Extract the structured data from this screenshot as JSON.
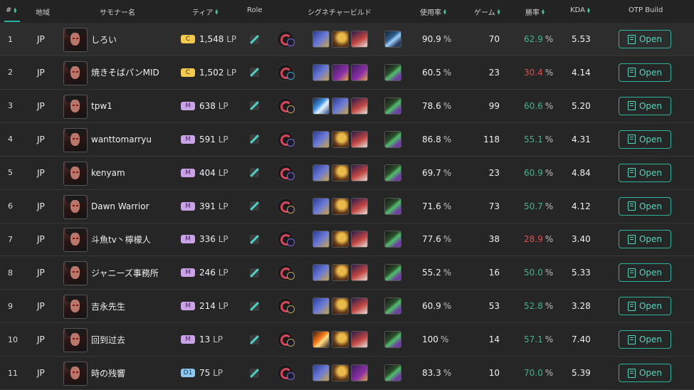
{
  "headers": {
    "rank": "#",
    "region": "地域",
    "summoner": "サモナー名",
    "tier": "ティア",
    "role": "Role",
    "build": "シグネチャービルド",
    "pickrate": "使用率",
    "games": "ゲーム",
    "winrate": "勝率",
    "kda": "KDA",
    "otp": "OTP Build"
  },
  "colors": {
    "accent": "#2fb39c",
    "good": "#3fb58c",
    "bad": "#e8484f"
  },
  "rows": [
    {
      "rank": "1",
      "region": "JP",
      "name": "しろい",
      "tier": "C",
      "lp": "1,548",
      "lp_unit": "LP",
      "pick": "90.9",
      "games": "70",
      "wr": "62.9",
      "wr_state": "good",
      "kda": "5.53",
      "button": "Open",
      "keystone_sub": "purple",
      "items": [
        "blue",
        "gold",
        "red"
      ],
      "boot": "blue"
    },
    {
      "rank": "2",
      "region": "JP",
      "name": "焼きそばパンMID",
      "tier": "C",
      "lp": "1,502",
      "lp_unit": "LP",
      "pick": "60.5",
      "games": "23",
      "wr": "30.4",
      "wr_state": "bad",
      "kda": "4.14",
      "button": "Open",
      "keystone_sub": "teal",
      "items": [
        "blue",
        "purple",
        "purple"
      ],
      "boot": "green"
    },
    {
      "rank": "3",
      "region": "JP",
      "name": "tpw1",
      "tier": "M",
      "lp": "638",
      "lp_unit": "LP",
      "pick": "78.6",
      "games": "99",
      "wr": "60.6",
      "wr_state": "good",
      "kda": "5.20",
      "button": "Open",
      "keystone_sub": "gold",
      "items": [
        "shard",
        "blue",
        "red"
      ],
      "boot": "green"
    },
    {
      "rank": "4",
      "region": "JP",
      "name": "wanttomarryu",
      "tier": "M",
      "lp": "591",
      "lp_unit": "LP",
      "pick": "86.8",
      "games": "118",
      "wr": "55.1",
      "wr_state": "good",
      "kda": "4.31",
      "button": "Open",
      "keystone_sub": "purple",
      "items": [
        "blue",
        "gold",
        "red"
      ],
      "boot": "green"
    },
    {
      "rank": "5",
      "region": "JP",
      "name": "kenyam",
      "tier": "M",
      "lp": "404",
      "lp_unit": "LP",
      "pick": "69.7",
      "games": "23",
      "wr": "60.9",
      "wr_state": "good",
      "kda": "4.84",
      "button": "Open",
      "keystone_sub": "purple",
      "items": [
        "blue",
        "gold",
        "red"
      ],
      "boot": "green"
    },
    {
      "rank": "6",
      "region": "JP",
      "name": "Dawn Warrior",
      "tier": "M",
      "lp": "391",
      "lp_unit": "LP",
      "pick": "71.6",
      "games": "73",
      "wr": "50.7",
      "wr_state": "good",
      "kda": "4.12",
      "button": "Open",
      "keystone_sub": "gold",
      "items": [
        "blue",
        "gold",
        "red"
      ],
      "boot": "green"
    },
    {
      "rank": "7",
      "region": "JP",
      "name": "斗魚tv丶檸檬人",
      "tier": "M",
      "lp": "336",
      "lp_unit": "LP",
      "pick": "77.6",
      "games": "38",
      "wr": "28.9",
      "wr_state": "bad",
      "kda": "3.40",
      "button": "Open",
      "keystone_sub": "purple",
      "items": [
        "blue",
        "gold",
        "red"
      ],
      "boot": "green"
    },
    {
      "rank": "8",
      "region": "JP",
      "name": "ジャニーズ事務所",
      "tier": "M",
      "lp": "246",
      "lp_unit": "LP",
      "pick": "55.2",
      "games": "16",
      "wr": "50.0",
      "wr_state": "good",
      "kda": "5.33",
      "button": "Open",
      "keystone_sub": "gold",
      "items": [
        "blue",
        "gold",
        "red"
      ],
      "boot": "green"
    },
    {
      "rank": "9",
      "region": "JP",
      "name": "吉永先生",
      "tier": "M",
      "lp": "214",
      "lp_unit": "LP",
      "pick": "60.9",
      "games": "53",
      "wr": "52.8",
      "wr_state": "good",
      "kda": "3.28",
      "button": "Open",
      "keystone_sub": "gold",
      "items": [
        "blue",
        "gold",
        "red"
      ],
      "boot": "green"
    },
    {
      "rank": "10",
      "region": "JP",
      "name": "回到过去",
      "tier": "M",
      "lp": "13",
      "lp_unit": "LP",
      "pick": "100",
      "games": "14",
      "wr": "57.1",
      "wr_state": "good",
      "kda": "7.40",
      "button": "Open",
      "keystone_sub": "gold",
      "items": [
        "flame",
        "gold",
        "red"
      ],
      "boot": "green"
    },
    {
      "rank": "11",
      "region": "JP",
      "name": "時の残響",
      "tier": "D1",
      "lp": "75",
      "lp_unit": "LP",
      "pick": "83.3",
      "games": "10",
      "wr": "70.0",
      "wr_state": "good",
      "kda": "5.39",
      "button": "Open",
      "keystone_sub": "purple",
      "items": [
        "blue",
        "gold",
        "purple"
      ],
      "boot": "green"
    }
  ],
  "pct_sign": "%"
}
